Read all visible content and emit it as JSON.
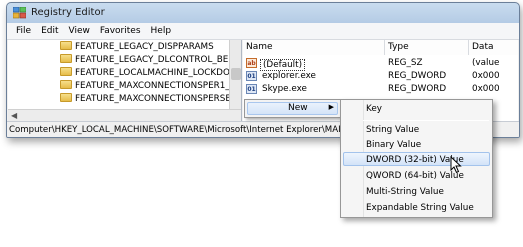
{
  "window": {
    "title": "Registry Editor",
    "menu": [
      "File",
      "Edit",
      "View",
      "Favorites",
      "Help"
    ]
  },
  "tree": {
    "items": [
      "FEATURE_LEGACY_DISPPARAMS",
      "FEATURE_LEGACY_DLCONTROL_BEHAVIC",
      "FEATURE_LOCALMACHINE_LOCKDOWN",
      "FEATURE_MAXCONNECTIONSPER1_0SER\\",
      "FEATURE_MAXCONNECTIONSPERSERVER"
    ]
  },
  "values": {
    "columns": [
      "Name",
      "Type",
      "Data"
    ],
    "rows": [
      {
        "icon": "string-value-icon",
        "name": "(Default)",
        "type": "REG_SZ",
        "data": "(value"
      },
      {
        "icon": "binary-value-icon",
        "name": "explorer.exe",
        "type": "REG_DWORD",
        "data": "0x000"
      },
      {
        "icon": "binary-value-icon",
        "name": "Skype.exe",
        "type": "REG_DWORD",
        "data": "0x000"
      }
    ]
  },
  "status_path": "Computer\\HKEY_LOCAL_MACHINE\\SOFTWARE\\Microsoft\\Internet Explorer\\MAIN\\FeatureCo",
  "context_menu": {
    "new_label": "New",
    "submenu": [
      "Key",
      "String Value",
      "Binary Value",
      "DWORD (32-bit) Value",
      "QWORD (64-bit) Value",
      "Multi-String Value",
      "Expandable String Value"
    ],
    "highlighted": "DWORD (32-bit) Value"
  }
}
